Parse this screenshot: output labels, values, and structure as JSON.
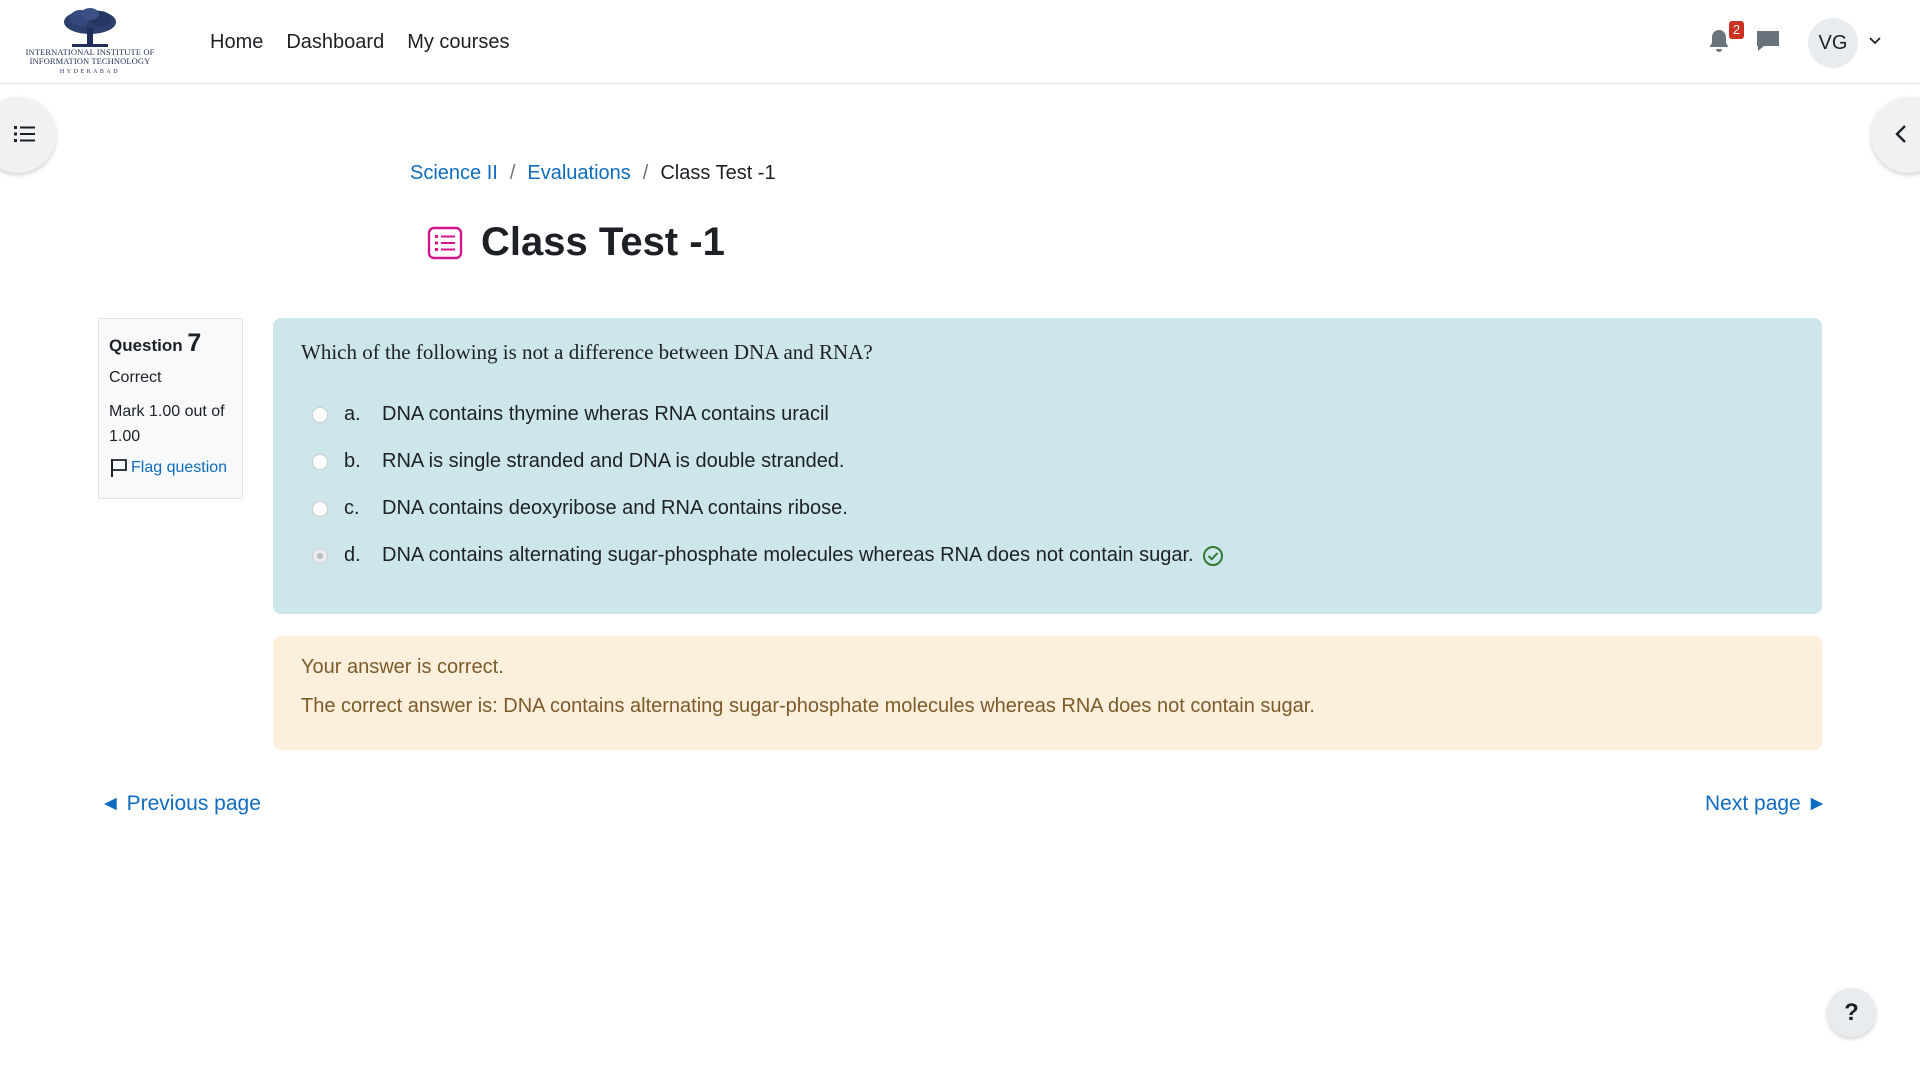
{
  "logo": {
    "line1": "INTERNATIONAL INSTITUTE OF",
    "line2": "INFORMATION TECHNOLOGY",
    "line3": "HYDERABAD"
  },
  "nav": {
    "home": "Home",
    "dashboard": "Dashboard",
    "my_courses": "My courses"
  },
  "user": {
    "notification_count": "2",
    "initials": "VG"
  },
  "breadcrumb": {
    "course": "Science II",
    "section": "Evaluations",
    "current": "Class Test -1",
    "separator": "/"
  },
  "page": {
    "title": "Class Test -1"
  },
  "question_info": {
    "label": "Question",
    "number": "7",
    "state": "Correct",
    "grade": "Mark 1.00 out of 1.00",
    "flag": "Flag question"
  },
  "question": {
    "text": "Which of the following is not a difference between DNA and RNA?",
    "answers": [
      {
        "letter": "a.",
        "text": "DNA contains thymine wheras RNA contains uracil"
      },
      {
        "letter": "b.",
        "text": "RNA is single stranded and DNA is double stranded."
      },
      {
        "letter": "c.",
        "text": "DNA contains deoxyribose and RNA contains ribose."
      },
      {
        "letter": "d.",
        "text": "DNA contains alternating sugar-phosphate molecules whereas RNA does not contain sugar."
      }
    ],
    "selected": "d."
  },
  "feedback": {
    "result": "Your answer is correct.",
    "correct_answer": "The correct answer is: DNA contains alternating sugar-phosphate molecules whereas RNA does not contain sugar."
  },
  "navigation": {
    "prev": "◄ Previous page",
    "next": "Next page ►"
  },
  "help": {
    "label": "?"
  },
  "colors": {
    "link": "#0f6cbf",
    "question_bg": "#cce6ea",
    "feedback_bg": "#fcefdc",
    "feedback_text": "#7d5a29",
    "badge": "#ca3120",
    "quiz_icon": "#d4148b",
    "correct_check": "#357a32"
  }
}
